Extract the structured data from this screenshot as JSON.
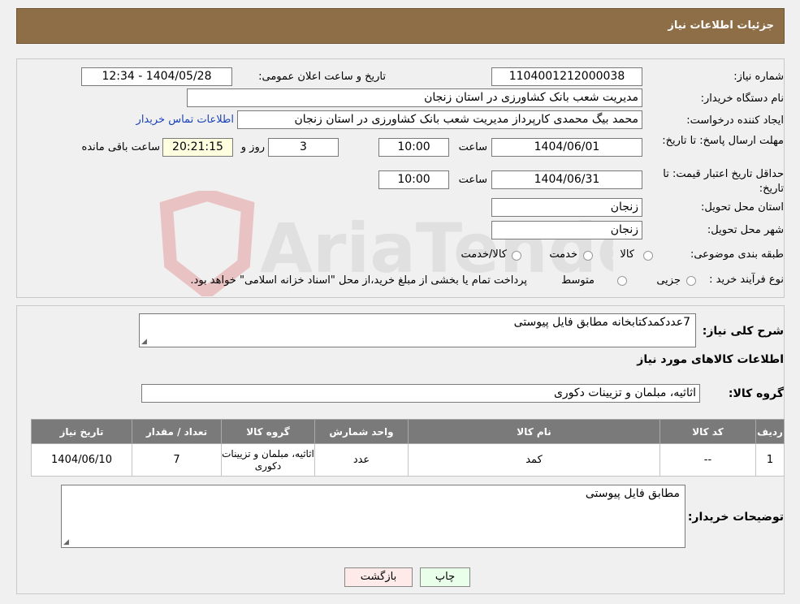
{
  "header": {
    "title": "جزئیات اطلاعات نیاز"
  },
  "form": {
    "need_number_label": "شماره نیاز:",
    "need_number": "1104001212000038",
    "announce_label": "تاریخ و ساعت اعلان عمومی:",
    "announce_value": "1404/05/28 - 12:34",
    "buyer_org_label": "نام دستگاه خریدار:",
    "buyer_org": "مدیریت شعب بانک کشاورزی در استان زنجان",
    "creator_label": "ایجاد کننده درخواست:",
    "creator": "محمد بیگ محمدی کارپرداز مدیریت شعب بانک کشاورزی در استان زنجان",
    "contact_link": "اطلاعات تماس خریدار",
    "deadline_label": "مهلت ارسال پاسخ: تا تاریخ:",
    "deadline_date": "1404/06/01",
    "time_label": "ساعت",
    "deadline_time": "10:00",
    "days_value": "3",
    "days_label": "روز و",
    "remaining_time": "20:21:15",
    "remaining_label": "ساعت باقی مانده",
    "validity_label": "حداقل تاریخ اعتبار قیمت: تا تاریخ:",
    "validity_date": "1404/06/31",
    "validity_time": "10:00",
    "province_label": "استان محل تحویل:",
    "province": "زنجان",
    "city_label": "شهر محل تحویل:",
    "city": "زنجان",
    "category_label": "طبقه بندی موضوعی:",
    "category_options": [
      "کالا",
      "خدمت",
      "کالا/خدمت"
    ],
    "process_label": "نوع فرآیند خرید :",
    "process_options": [
      "جزیی",
      "متوسط"
    ],
    "process_note": "پرداخت تمام یا بخشی از مبلغ خرید،از محل \"اسناد خزانه اسلامی\" خواهد بود."
  },
  "details": {
    "desc_label": "شرح کلی نیاز:",
    "desc_value": "7عددکمدکتابخانه مطابق فایل پیوستی",
    "goods_info_title": "اطلاعات کالاهای مورد نیاز",
    "group_label": "گروه کالا:",
    "group_value": "اثاثیه، مبلمان و تزیینات دکوری",
    "table": {
      "headers": [
        "ردیف",
        "کد کالا",
        "نام کالا",
        "واحد شمارش",
        "گروه کالا",
        "تعداد / مقدار",
        "تاریخ نیاز"
      ],
      "rows": [
        [
          "1",
          "--",
          "کمد",
          "عدد",
          "اثاثیه، مبلمان و تزیینات دکوری",
          "7",
          "1404/06/10"
        ]
      ]
    },
    "buyer_notes_label": "توضیحات خریدار:",
    "buyer_notes": "مطابق فایل پیوستی"
  },
  "buttons": {
    "print": "چاپ",
    "back": "بازگشت"
  },
  "watermark": "AriaTender.neT"
}
